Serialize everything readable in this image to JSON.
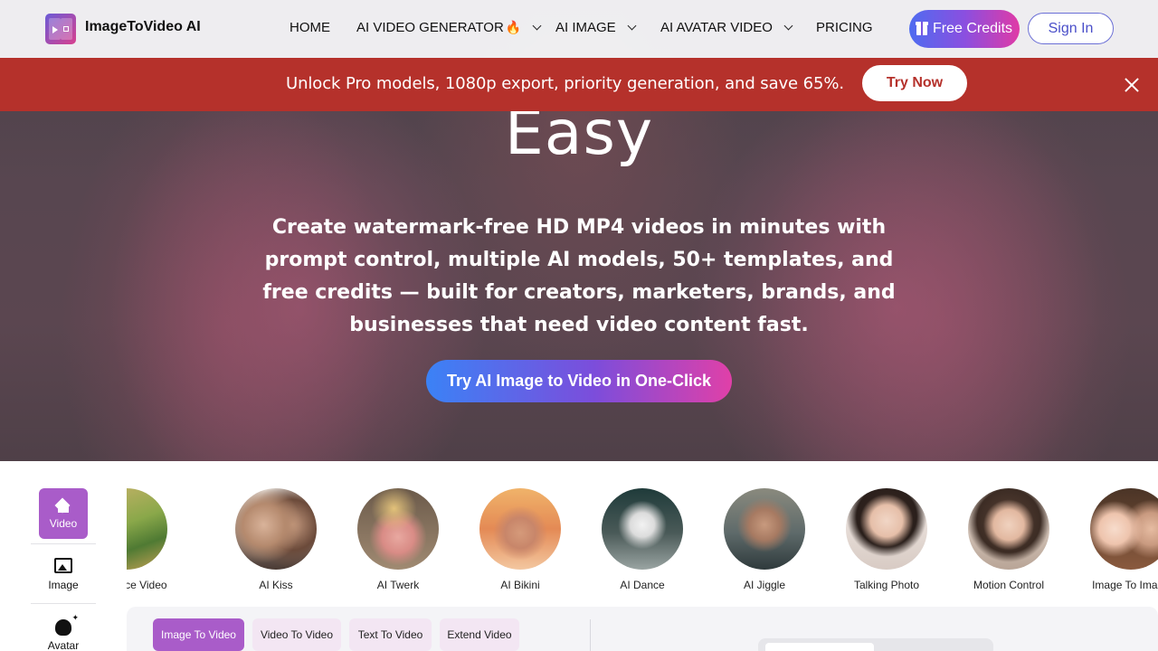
{
  "nav": {
    "logo_text": "ImageToVideo AI",
    "items": [
      {
        "label": "HOME"
      },
      {
        "label": "AI VIDEO GENERATOR",
        "badge": "🔥"
      },
      {
        "label": "AI IMAGE"
      },
      {
        "label": "AI AVATAR VIDEO"
      },
      {
        "label": "PRICING"
      }
    ],
    "free_credits": "Free Credits",
    "sign_in": "Sign In"
  },
  "promo": {
    "text": "Unlock Pro models, 1080p export, priority generation, and save 65%.",
    "button": "Try Now"
  },
  "hero": {
    "headline_visible": "Easy",
    "subheadline": "Create watermark-free HD MP4 videos in minutes with prompt control, multiple AI models, 50+ templates, and free credits — built for creators, marketers, brands, and businesses that need video content fast.",
    "cta": "Try AI Image to Video in One-Click"
  },
  "sidebar": {
    "items": [
      {
        "label": "Video",
        "icon": "home-icon",
        "active": true
      },
      {
        "label": "Image",
        "icon": "image-icon",
        "active": false
      },
      {
        "label": "Avatar",
        "icon": "avatar-icon",
        "active": false
      }
    ]
  },
  "features": [
    {
      "label": "Reference Video"
    },
    {
      "label": "AI Kiss"
    },
    {
      "label": "AI Twerk"
    },
    {
      "label": "AI Bikini"
    },
    {
      "label": "AI Dance"
    },
    {
      "label": "AI Jiggle"
    },
    {
      "label": "Talking Photo"
    },
    {
      "label": "Motion Control"
    },
    {
      "label": "Image To Image"
    }
  ],
  "tool_tabs": [
    {
      "label": "Image To Video",
      "active": true
    },
    {
      "label": "Video To Video",
      "active": false
    },
    {
      "label": "Text To Video",
      "active": false
    },
    {
      "label": "Extend Video",
      "active": false
    }
  ],
  "colors": {
    "accent_purple": "#a95cc9",
    "promo_red": "#b5312b",
    "cta_gradient_start": "#3b82f6",
    "cta_gradient_end": "#e040a8"
  }
}
